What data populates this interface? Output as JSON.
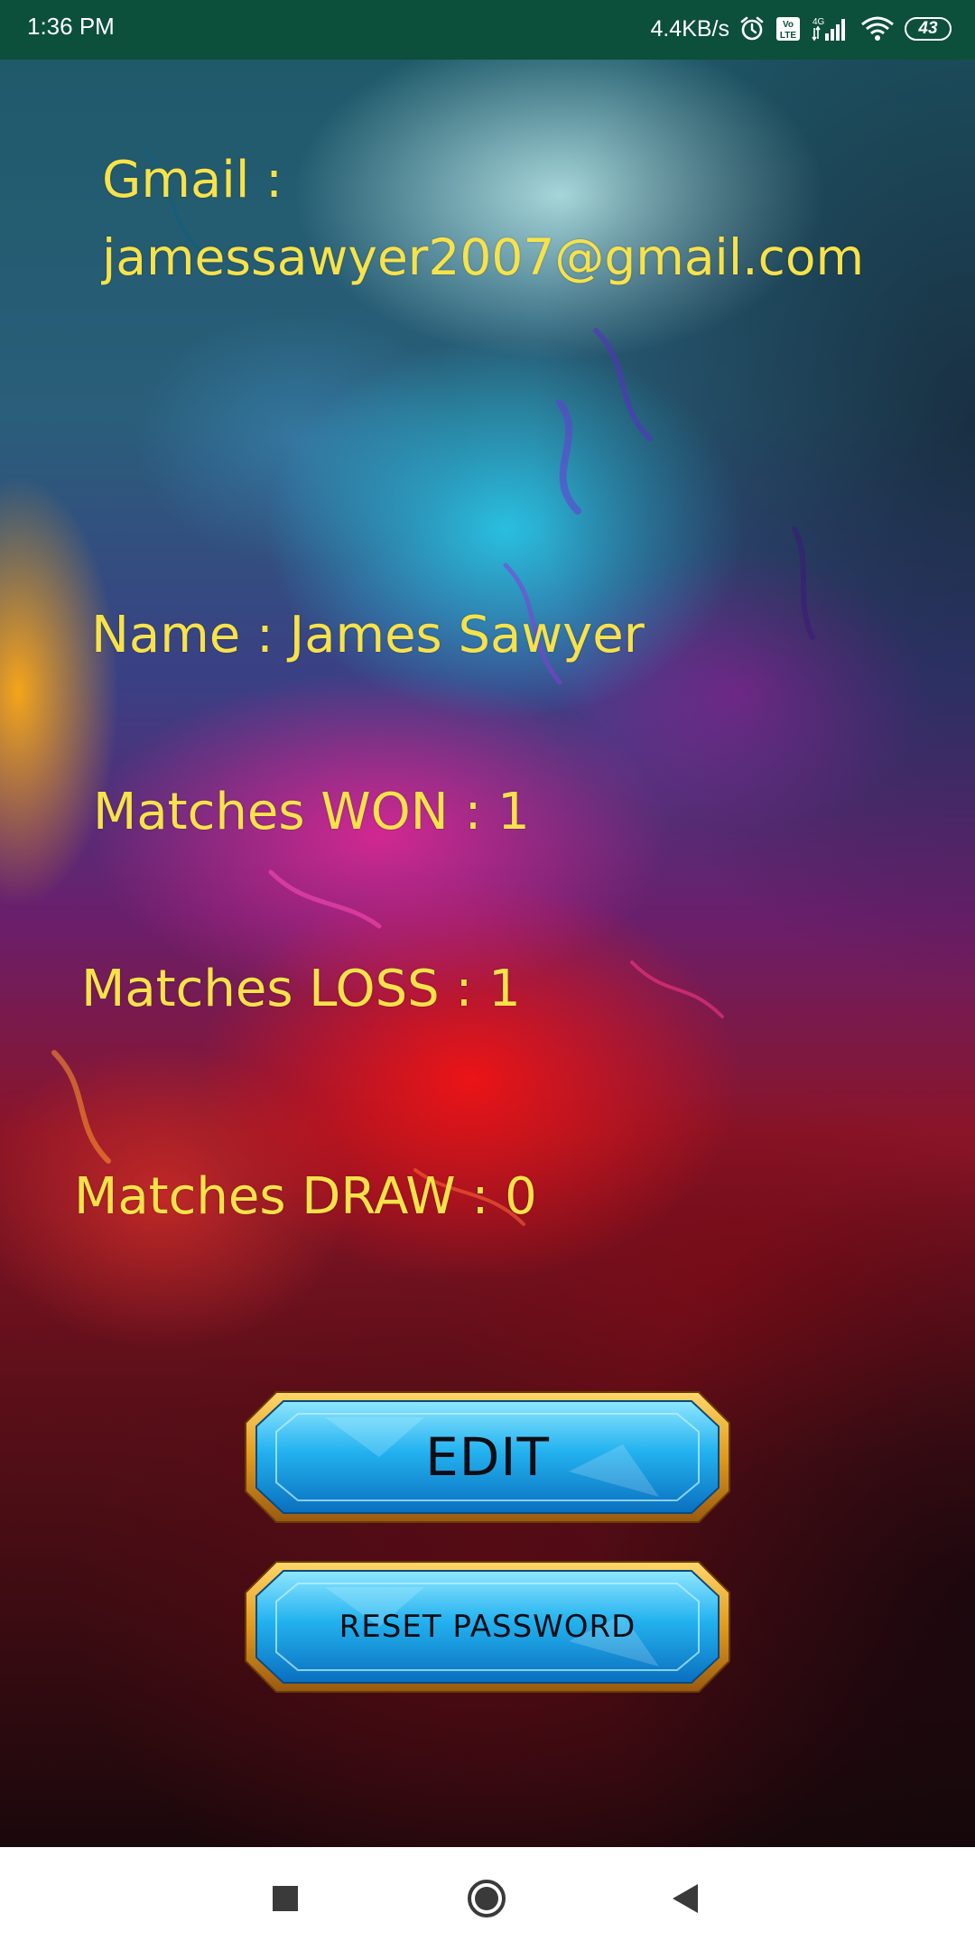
{
  "status_bar": {
    "time": "1:36 PM",
    "net_speed": "4.4KB/s",
    "battery": "43",
    "icons": [
      "alarm-icon",
      "volte-icon",
      "signal-4g-icon",
      "wifi-icon",
      "battery-icon"
    ]
  },
  "profile": {
    "gmail_label": "Gmail :",
    "gmail_value": "jamessawyer2007@gmail.com",
    "name": "Name : James Sawyer",
    "won": "Matches WON : 1",
    "loss": "Matches LOSS : 1",
    "draw": "Matches DRAW : 0"
  },
  "buttons": {
    "edit": "EDIT",
    "reset_password": "RESET PASSWORD"
  },
  "nav_bar": {
    "icons": [
      "recents-square-icon",
      "home-circle-icon",
      "back-triangle-icon"
    ]
  },
  "colors": {
    "status_bar": "#0c4f3a",
    "text_accent": "#f7e24a",
    "button_blue": "#1aa8e6",
    "button_gold": "#e5a324"
  }
}
